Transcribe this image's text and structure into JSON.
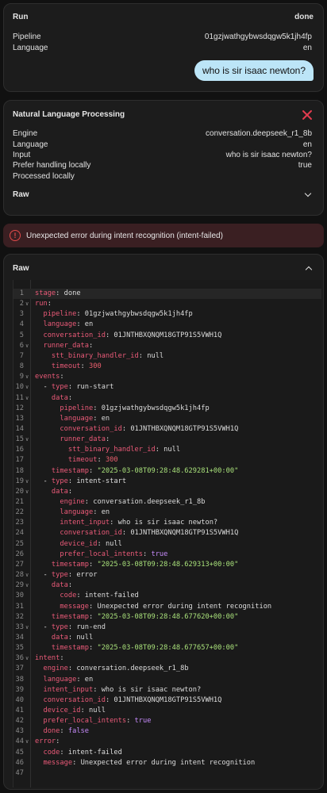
{
  "run_card": {
    "title": "Run",
    "status": "done",
    "rows": [
      {
        "key": "Pipeline",
        "value": "01gzjwathgybwsdqgw5k1jh4fp"
      },
      {
        "key": "Language",
        "value": "en"
      }
    ],
    "bubble": "who is sir isaac newton?"
  },
  "nlp_card": {
    "title": "Natural Language Processing",
    "rows": [
      {
        "key": "Engine",
        "value": "conversation.deepseek_r1_8b"
      },
      {
        "key": "Language",
        "value": "en"
      },
      {
        "key": "Input",
        "value": "who is sir isaac newton?"
      },
      {
        "key": "Prefer handling locally",
        "value": "true"
      },
      {
        "key": "Processed locally",
        "value": ""
      }
    ],
    "raw_label": "Raw"
  },
  "alert": {
    "text": "Unexpected error during intent recognition (intent-failed)"
  },
  "raw_card": {
    "title": "Raw",
    "lines": [
      {
        "n": "1",
        "fold": false,
        "tokens": [
          [
            "k",
            "stage"
          ],
          [
            "p",
            ": "
          ],
          [
            "p",
            "done"
          ]
        ]
      },
      {
        "n": "2",
        "fold": true,
        "tokens": [
          [
            "k",
            "run"
          ],
          [
            "p",
            ":"
          ]
        ]
      },
      {
        "n": "3",
        "fold": false,
        "tokens": [
          [
            "p",
            "  "
          ],
          [
            "k",
            "pipeline"
          ],
          [
            "p",
            ": "
          ],
          [
            "p",
            "01gzjwathgybwsdqgw5k1jh4fp"
          ]
        ]
      },
      {
        "n": "4",
        "fold": false,
        "tokens": [
          [
            "p",
            "  "
          ],
          [
            "k",
            "language"
          ],
          [
            "p",
            ": "
          ],
          [
            "p",
            "en"
          ]
        ]
      },
      {
        "n": "5",
        "fold": false,
        "tokens": [
          [
            "p",
            "  "
          ],
          [
            "k",
            "conversation_id"
          ],
          [
            "p",
            ": "
          ],
          [
            "p",
            "01JNTHBXQNQM18GTP91S5VWH1Q"
          ]
        ]
      },
      {
        "n": "6",
        "fold": true,
        "tokens": [
          [
            "p",
            "  "
          ],
          [
            "k",
            "runner_data"
          ],
          [
            "p",
            ":"
          ]
        ]
      },
      {
        "n": "7",
        "fold": false,
        "tokens": [
          [
            "p",
            "    "
          ],
          [
            "k",
            "stt_binary_handler_id"
          ],
          [
            "p",
            ": "
          ],
          [
            "p",
            "null"
          ]
        ]
      },
      {
        "n": "8",
        "fold": false,
        "tokens": [
          [
            "p",
            "    "
          ],
          [
            "k",
            "timeout"
          ],
          [
            "p",
            ": "
          ],
          [
            "n",
            "300"
          ]
        ]
      },
      {
        "n": "9",
        "fold": true,
        "tokens": [
          [
            "k",
            "events"
          ],
          [
            "p",
            ":"
          ]
        ]
      },
      {
        "n": "10",
        "fold": true,
        "tokens": [
          [
            "p",
            "  - "
          ],
          [
            "k",
            "type"
          ],
          [
            "p",
            ": "
          ],
          [
            "p",
            "run-start"
          ]
        ]
      },
      {
        "n": "11",
        "fold": true,
        "tokens": [
          [
            "p",
            "    "
          ],
          [
            "k",
            "data"
          ],
          [
            "p",
            ":"
          ]
        ]
      },
      {
        "n": "12",
        "fold": false,
        "tokens": [
          [
            "p",
            "      "
          ],
          [
            "k",
            "pipeline"
          ],
          [
            "p",
            ": "
          ],
          [
            "p",
            "01gzjwathgybwsdqgw5k1jh4fp"
          ]
        ]
      },
      {
        "n": "13",
        "fold": false,
        "tokens": [
          [
            "p",
            "      "
          ],
          [
            "k",
            "language"
          ],
          [
            "p",
            ": "
          ],
          [
            "p",
            "en"
          ]
        ]
      },
      {
        "n": "14",
        "fold": false,
        "tokens": [
          [
            "p",
            "      "
          ],
          [
            "k",
            "conversation_id"
          ],
          [
            "p",
            ": "
          ],
          [
            "p",
            "01JNTHBXQNQM18GTP91S5VWH1Q"
          ]
        ]
      },
      {
        "n": "15",
        "fold": true,
        "tokens": [
          [
            "p",
            "      "
          ],
          [
            "k",
            "runner_data"
          ],
          [
            "p",
            ":"
          ]
        ]
      },
      {
        "n": "16",
        "fold": false,
        "tokens": [
          [
            "p",
            "        "
          ],
          [
            "k",
            "stt_binary_handler_id"
          ],
          [
            "p",
            ": "
          ],
          [
            "p",
            "null"
          ]
        ]
      },
      {
        "n": "17",
        "fold": false,
        "tokens": [
          [
            "p",
            "        "
          ],
          [
            "k",
            "timeout"
          ],
          [
            "p",
            ": "
          ],
          [
            "n",
            "300"
          ]
        ]
      },
      {
        "n": "18",
        "fold": false,
        "tokens": [
          [
            "p",
            "    "
          ],
          [
            "k",
            "timestamp"
          ],
          [
            "p",
            ": "
          ],
          [
            "s",
            "\"2025-03-08T09:28:48.629281+00:00\""
          ]
        ]
      },
      {
        "n": "19",
        "fold": true,
        "tokens": [
          [
            "p",
            "  - "
          ],
          [
            "k",
            "type"
          ],
          [
            "p",
            ": "
          ],
          [
            "p",
            "intent-start"
          ]
        ]
      },
      {
        "n": "20",
        "fold": true,
        "tokens": [
          [
            "p",
            "    "
          ],
          [
            "k",
            "data"
          ],
          [
            "p",
            ":"
          ]
        ]
      },
      {
        "n": "21",
        "fold": false,
        "tokens": [
          [
            "p",
            "      "
          ],
          [
            "k",
            "engine"
          ],
          [
            "p",
            ": "
          ],
          [
            "p",
            "conversation.deepseek_r1_8b"
          ]
        ]
      },
      {
        "n": "22",
        "fold": false,
        "tokens": [
          [
            "p",
            "      "
          ],
          [
            "k",
            "language"
          ],
          [
            "p",
            ": "
          ],
          [
            "p",
            "en"
          ]
        ]
      },
      {
        "n": "23",
        "fold": false,
        "tokens": [
          [
            "p",
            "      "
          ],
          [
            "k",
            "intent_input"
          ],
          [
            "p",
            ": "
          ],
          [
            "p",
            "who is sir isaac newton?"
          ]
        ]
      },
      {
        "n": "24",
        "fold": false,
        "tokens": [
          [
            "p",
            "      "
          ],
          [
            "k",
            "conversation_id"
          ],
          [
            "p",
            ": "
          ],
          [
            "p",
            "01JNTHBXQNQM18GTP91S5VWH1Q"
          ]
        ]
      },
      {
        "n": "25",
        "fold": false,
        "tokens": [
          [
            "p",
            "      "
          ],
          [
            "k",
            "device_id"
          ],
          [
            "p",
            ": "
          ],
          [
            "p",
            "null"
          ]
        ]
      },
      {
        "n": "26",
        "fold": false,
        "tokens": [
          [
            "p",
            "      "
          ],
          [
            "k",
            "prefer_local_intents"
          ],
          [
            "p",
            ": "
          ],
          [
            "b",
            "true"
          ]
        ]
      },
      {
        "n": "27",
        "fold": false,
        "tokens": [
          [
            "p",
            "    "
          ],
          [
            "k",
            "timestamp"
          ],
          [
            "p",
            ": "
          ],
          [
            "s",
            "\"2025-03-08T09:28:48.629313+00:00\""
          ]
        ]
      },
      {
        "n": "28",
        "fold": true,
        "tokens": [
          [
            "p",
            "  - "
          ],
          [
            "k",
            "type"
          ],
          [
            "p",
            ": "
          ],
          [
            "p",
            "error"
          ]
        ]
      },
      {
        "n": "29",
        "fold": true,
        "tokens": [
          [
            "p",
            "    "
          ],
          [
            "k",
            "data"
          ],
          [
            "p",
            ":"
          ]
        ]
      },
      {
        "n": "30",
        "fold": false,
        "tokens": [
          [
            "p",
            "      "
          ],
          [
            "k",
            "code"
          ],
          [
            "p",
            ": "
          ],
          [
            "p",
            "intent-failed"
          ]
        ]
      },
      {
        "n": "31",
        "fold": false,
        "tokens": [
          [
            "p",
            "      "
          ],
          [
            "k",
            "message"
          ],
          [
            "p",
            ": "
          ],
          [
            "p",
            "Unexpected error during intent recognition"
          ]
        ]
      },
      {
        "n": "32",
        "fold": false,
        "tokens": [
          [
            "p",
            "    "
          ],
          [
            "k",
            "timestamp"
          ],
          [
            "p",
            ": "
          ],
          [
            "s",
            "\"2025-03-08T09:28:48.677620+00:00\""
          ]
        ]
      },
      {
        "n": "33",
        "fold": true,
        "tokens": [
          [
            "p",
            "  - "
          ],
          [
            "k",
            "type"
          ],
          [
            "p",
            ": "
          ],
          [
            "p",
            "run-end"
          ]
        ]
      },
      {
        "n": "34",
        "fold": false,
        "tokens": [
          [
            "p",
            "    "
          ],
          [
            "k",
            "data"
          ],
          [
            "p",
            ": "
          ],
          [
            "p",
            "null"
          ]
        ]
      },
      {
        "n": "35",
        "fold": false,
        "tokens": [
          [
            "p",
            "    "
          ],
          [
            "k",
            "timestamp"
          ],
          [
            "p",
            ": "
          ],
          [
            "s",
            "\"2025-03-08T09:28:48.677657+00:00\""
          ]
        ]
      },
      {
        "n": "36",
        "fold": true,
        "tokens": [
          [
            "k",
            "intent"
          ],
          [
            "p",
            ":"
          ]
        ]
      },
      {
        "n": "37",
        "fold": false,
        "tokens": [
          [
            "p",
            "  "
          ],
          [
            "k",
            "engine"
          ],
          [
            "p",
            ": "
          ],
          [
            "p",
            "conversation.deepseek_r1_8b"
          ]
        ]
      },
      {
        "n": "38",
        "fold": false,
        "tokens": [
          [
            "p",
            "  "
          ],
          [
            "k",
            "language"
          ],
          [
            "p",
            ": "
          ],
          [
            "p",
            "en"
          ]
        ]
      },
      {
        "n": "39",
        "fold": false,
        "tokens": [
          [
            "p",
            "  "
          ],
          [
            "k",
            "intent_input"
          ],
          [
            "p",
            ": "
          ],
          [
            "p",
            "who is sir isaac newton?"
          ]
        ]
      },
      {
        "n": "40",
        "fold": false,
        "tokens": [
          [
            "p",
            "  "
          ],
          [
            "k",
            "conversation_id"
          ],
          [
            "p",
            ": "
          ],
          [
            "p",
            "01JNTHBXQNQM18GTP91S5VWH1Q"
          ]
        ]
      },
      {
        "n": "41",
        "fold": false,
        "tokens": [
          [
            "p",
            "  "
          ],
          [
            "k",
            "device_id"
          ],
          [
            "p",
            ": "
          ],
          [
            "p",
            "null"
          ]
        ]
      },
      {
        "n": "42",
        "fold": false,
        "tokens": [
          [
            "p",
            "  "
          ],
          [
            "k",
            "prefer_local_intents"
          ],
          [
            "p",
            ": "
          ],
          [
            "b",
            "true"
          ]
        ]
      },
      {
        "n": "43",
        "fold": false,
        "tokens": [
          [
            "p",
            "  "
          ],
          [
            "k",
            "done"
          ],
          [
            "p",
            ": "
          ],
          [
            "b",
            "false"
          ]
        ]
      },
      {
        "n": "44",
        "fold": true,
        "tokens": [
          [
            "k",
            "error"
          ],
          [
            "p",
            ":"
          ]
        ]
      },
      {
        "n": "45",
        "fold": false,
        "tokens": [
          [
            "p",
            "  "
          ],
          [
            "k",
            "code"
          ],
          [
            "p",
            ": "
          ],
          [
            "p",
            "intent-failed"
          ]
        ]
      },
      {
        "n": "46",
        "fold": false,
        "tokens": [
          [
            "p",
            "  "
          ],
          [
            "k",
            "message"
          ],
          [
            "p",
            ": "
          ],
          [
            "p",
            "Unexpected error during intent recognition"
          ]
        ]
      },
      {
        "n": "47",
        "fold": false,
        "tokens": []
      }
    ]
  }
}
